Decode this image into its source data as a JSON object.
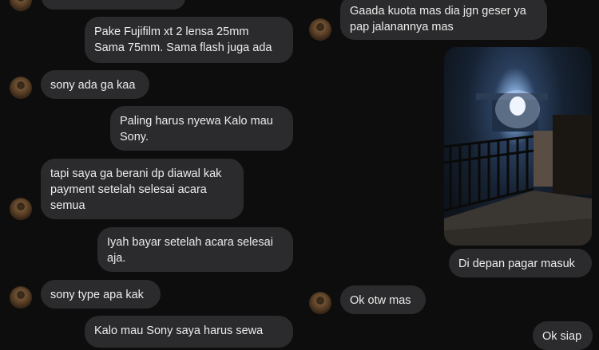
{
  "left_column": {
    "messages": [
      {
        "text": "",
        "side": "incoming"
      },
      {
        "text": "Pake Fujifilm xt 2 lensa 25mm\nSama 75mm. Sama flash juga ada",
        "side": "outgoing"
      },
      {
        "text": "sony ada ga kaa",
        "side": "incoming"
      },
      {
        "text": "Paling harus nyewa Kalo mau\nSony.",
        "side": "outgoing"
      },
      {
        "text": "tapi saya ga berani dp diawal kak\npayment setelah selesai acara\nsemua",
        "side": "incoming"
      },
      {
        "text": "Iyah bayar setelah acara selesai\naja.",
        "side": "outgoing"
      },
      {
        "text": "sony type apa kak",
        "side": "incoming"
      },
      {
        "text": "Kalo mau Sony saya harus sewa",
        "side": "outgoing"
      }
    ]
  },
  "right_column": {
    "messages": [
      {
        "text": "Gaada kuota mas dia jgn geser ya\npap jalanannya mas",
        "side": "incoming"
      },
      {
        "text": "Di depan pagar masuk",
        "side": "outgoing"
      },
      {
        "text": "Ok otw mas",
        "side": "incoming"
      },
      {
        "text": "Ok siap",
        "side": "outgoing"
      }
    ],
    "photo_alt": "photo-of-gate-at-night"
  },
  "colors": {
    "background": "#0d0d0d",
    "bubble": "#2b2b2d",
    "text": "#ececec"
  }
}
